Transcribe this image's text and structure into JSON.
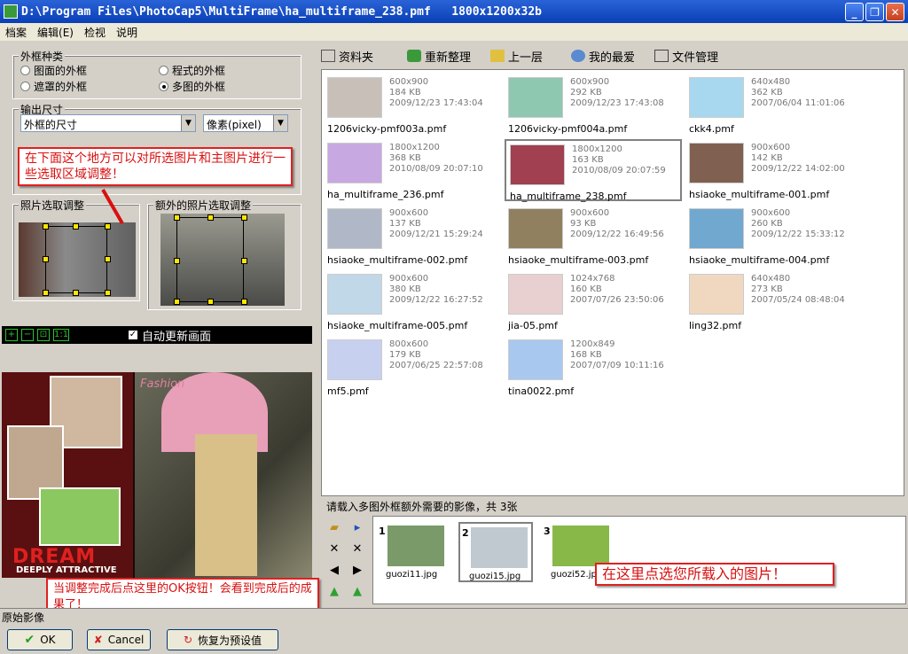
{
  "window": {
    "title": "D:\\Program Files\\PhotoCap5\\MultiFrame\\ha_multiframe_238.pmf   1800x1200x32b",
    "minimize": "_",
    "maximize": "❐",
    "close": "✕"
  },
  "menu": [
    "档案",
    "编辑(E)",
    "检视",
    "说明"
  ],
  "frame_type": {
    "title": "外框种类",
    "options": [
      "图面的外框",
      "程式的外框",
      "遮罩的外框",
      "多图的外框"
    ],
    "selected": "多图的外框"
  },
  "output_size": {
    "title": "输出尺寸",
    "size_select": "外框的尺寸",
    "unit_select": "像素(pixel)"
  },
  "callouts": {
    "top": "在下面这个地方可以对所选图片和主图片进行一些选取区域调整！",
    "bottom": "当调整完成后点这里的OK按钮！会看到完成后的成果了！",
    "right": "在这里点选您所载入的图片！"
  },
  "adjust": {
    "photo_label": "照片选取调整",
    "extra_label": "额外的照片选取调整"
  },
  "preview": {
    "auto_update": "自动更新画面",
    "zoom_in": "+",
    "zoom_out": "−",
    "fit": "⊡",
    "actual": "1:1",
    "dream": "DREAM",
    "deeply": "DEEPLY ATTRACTIVE",
    "fashion": "Fashion"
  },
  "toolbar": {
    "folder": "资料夹",
    "refresh": "重新整理",
    "up": "上一层",
    "favorites": "我的最爱",
    "file_manager": "文件管理"
  },
  "files": [
    {
      "name": "1206vicky-pmf003a.pmf",
      "dims": "600x900",
      "size": "184 KB",
      "date": "2009/12/23 17:43:04",
      "color": "#c8c0b8"
    },
    {
      "name": "1206vicky-pmf004a.pmf",
      "dims": "600x900",
      "size": "292 KB",
      "date": "2009/12/23 17:43:08",
      "color": "#8fc8b0"
    },
    {
      "name": "ckk4.pmf",
      "dims": "640x480",
      "size": "362 KB",
      "date": "2007/06/04 11:01:06",
      "color": "#a8d8f0"
    },
    {
      "name": "ha_multiframe_236.pmf",
      "dims": "1800x1200",
      "size": "368 KB",
      "date": "2010/08/09 20:07:10",
      "color": "#c8a8e0"
    },
    {
      "name": "ha_multiframe_238.pmf",
      "dims": "1800x1200",
      "size": "163 KB",
      "date": "2010/08/09 20:07:59",
      "color": "#a04050"
    },
    {
      "name": "hsiaoke_multiframe-001.pmf",
      "dims": "900x600",
      "size": "142 KB",
      "date": "2009/12/22 14:02:00",
      "color": "#806050"
    },
    {
      "name": "hsiaoke_multiframe-002.pmf",
      "dims": "900x600",
      "size": "137 KB",
      "date": "2009/12/21 15:29:24",
      "color": "#b0b8c8"
    },
    {
      "name": "hsiaoke_multiframe-003.pmf",
      "dims": "900x600",
      "size": "93 KB",
      "date": "2009/12/22 16:49:56",
      "color": "#908060"
    },
    {
      "name": "hsiaoke_multiframe-004.pmf",
      "dims": "900x600",
      "size": "260 KB",
      "date": "2009/12/22 15:33:12",
      "color": "#70a8d0"
    },
    {
      "name": "hsiaoke_multiframe-005.pmf",
      "dims": "900x600",
      "size": "380 KB",
      "date": "2009/12/22 16:27:52",
      "color": "#c0d8e8"
    },
    {
      "name": "jia-05.pmf",
      "dims": "1024x768",
      "size": "160 KB",
      "date": "2007/07/26 23:50:06",
      "color": "#e8d0d0"
    },
    {
      "name": "ling32.pmf",
      "dims": "640x480",
      "size": "273 KB",
      "date": "2007/05/24 08:48:04",
      "color": "#f0d8c0"
    },
    {
      "name": "mf5.pmf",
      "dims": "800x600",
      "size": "179 KB",
      "date": "2007/06/25 22:57:08",
      "color": "#c8d0f0"
    },
    {
      "name": "tina0022.pmf",
      "dims": "1200x849",
      "size": "168 KB",
      "date": "2007/07/09 10:11:16",
      "color": "#a8c8f0"
    }
  ],
  "extra": {
    "status": "请载入多图外框额外需要的影像，共 3张",
    "images": [
      {
        "num": "1",
        "name": "guozi11.jpg",
        "color": "#7a9a6a"
      },
      {
        "num": "2",
        "name": "guozi15.jpg",
        "color": "#c0c8d0"
      },
      {
        "num": "3",
        "name": "guozi52.jpg",
        "color": "#88b848"
      }
    ]
  },
  "status_bar": "原始影像",
  "buttons": {
    "ok": "OK",
    "cancel": "Cancel",
    "reset": "恢复为预设值"
  }
}
